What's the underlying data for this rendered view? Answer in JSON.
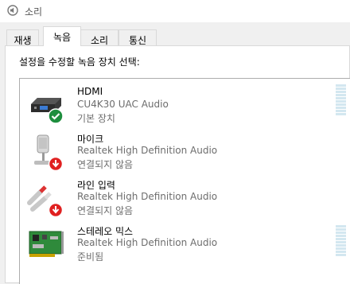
{
  "window": {
    "title": "소리"
  },
  "tabs": [
    {
      "label": "재생"
    },
    {
      "label": "녹음"
    },
    {
      "label": "소리"
    },
    {
      "label": "통신"
    }
  ],
  "panel": {
    "instruction": "설정을 수정할 녹음 장치 선택:"
  },
  "devices": [
    {
      "name": "HDMI",
      "description": "CU4K30 UAC Audio",
      "status": "기본 장치",
      "icon": "capture-device-icon",
      "badge": "green-check-icon"
    },
    {
      "name": "마이크",
      "description": "Realtek High Definition Audio",
      "status": "연결되지 않음",
      "icon": "microphone-icon",
      "badge": "red-down-arrow-icon"
    },
    {
      "name": "라인 입력",
      "description": "Realtek High Definition Audio",
      "status": "연결되지 않음",
      "icon": "rca-cable-icon",
      "badge": "red-down-arrow-icon"
    },
    {
      "name": "스테레오 믹스",
      "description": "Realtek High Definition Audio",
      "status": "준비됨",
      "icon": "sound-card-icon",
      "badge": ""
    }
  ],
  "colors": {
    "meter": "#d3e7f0",
    "check": "#1e8e3e",
    "disconnected": "#e02020"
  }
}
